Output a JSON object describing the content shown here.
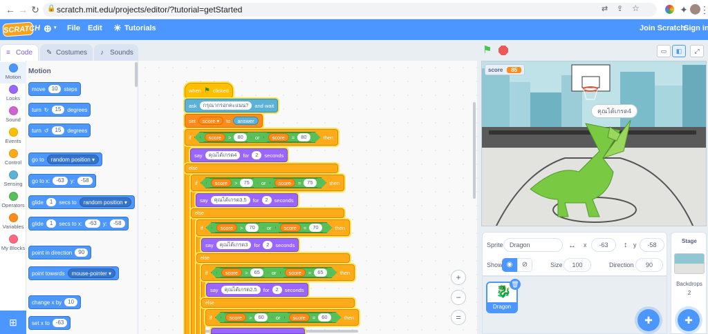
{
  "browser": {
    "url": "scratch.mit.edu/projects/editor/?tutorial=getStarted"
  },
  "menubar": {
    "logo": "SCRATCH",
    "file": "File",
    "edit": "Edit",
    "tutorials": "Tutorials",
    "join": "Join Scratch",
    "signin": "Sign in"
  },
  "tabs": {
    "code": "Code",
    "costumes": "Costumes",
    "sounds": "Sounds"
  },
  "categories": [
    {
      "label": "Motion",
      "color": "#4c97ff"
    },
    {
      "label": "Looks",
      "color": "#9966ff"
    },
    {
      "label": "Sound",
      "color": "#cf63cf"
    },
    {
      "label": "Events",
      "color": "#ffbf00"
    },
    {
      "label": "Control",
      "color": "#ffab19"
    },
    {
      "label": "Sensing",
      "color": "#5cb1d6"
    },
    {
      "label": "Operators",
      "color": "#59c059"
    },
    {
      "label": "Variables",
      "color": "#ff8c1a"
    },
    {
      "label": "My Blocks",
      "color": "#ff6680"
    }
  ],
  "palette": {
    "title": "Motion",
    "move": {
      "a": "move",
      "v": "10",
      "b": "steps"
    },
    "turn_right": {
      "a": "turn",
      "v": "15",
      "b": "degrees"
    },
    "turn_left": {
      "a": "turn",
      "v": "15",
      "b": "degrees"
    },
    "goto": {
      "a": "go to",
      "dd": "random position"
    },
    "gotoxy": {
      "a": "go to x:",
      "x": "-63",
      "b": "y:",
      "y": "-58"
    },
    "glide1": {
      "a": "glide",
      "v": "1",
      "b": "secs to",
      "dd": "random position"
    },
    "glide2": {
      "a": "glide",
      "v": "1",
      "b": "secs to x:",
      "x": "-63",
      "c": "y:",
      "y": "-58"
    },
    "point_dir": {
      "a": "point in direction",
      "v": "90"
    },
    "point_towards": {
      "a": "point towards",
      "dd": "mouse-pointer"
    },
    "change_x": {
      "a": "change x by",
      "v": "10"
    },
    "set_x": {
      "a": "set x to",
      "v": "-63"
    }
  },
  "script": {
    "when": {
      "a": "when",
      "b": "clicked"
    },
    "ask": {
      "a": "ask",
      "v": "กรุณากรอกคะแนน?",
      "b": "and wait"
    },
    "set": {
      "a": "set",
      "dd": "score",
      "b": "to",
      "v": "answer"
    },
    "if_label": "if",
    "then_label": "then",
    "else_label": "else",
    "or_label": "or",
    "say_label": "say",
    "for_label": "for",
    "seconds_label": "seconds",
    "var_name": "score",
    "gt": ">",
    "eq": "=",
    "conds": [
      {
        "gt_val": "80",
        "eq_val": "80",
        "msg": "คุณได้เกรด4",
        "secs": "2"
      },
      {
        "gt_val": "75",
        "eq_val": "75",
        "msg": "คุณได้เกรด3.5",
        "secs": "2"
      },
      {
        "gt_val": "70",
        "eq_val": "70",
        "msg": "คุณได้เกรด3",
        "secs": "2"
      },
      {
        "gt_val": "65",
        "eq_val": "65",
        "msg": "คุณได้เกรด2.5",
        "secs": "2"
      },
      {
        "gt_val": "60",
        "eq_val": "60"
      }
    ]
  },
  "zoom": {
    "in": "+",
    "out": "−",
    "reset": "="
  },
  "stage": {
    "score_label": "score",
    "score_value": "85",
    "speech": "คุณได้เกรด4"
  },
  "sprite_info": {
    "sprite_label": "Sprite",
    "sprite_name": "Dragon",
    "x_label": "x",
    "x_value": "-63",
    "y_label": "y",
    "y_value": "-58",
    "show_label": "Show",
    "size_label": "Size",
    "size_value": "100",
    "direction_label": "Direction",
    "direction_value": "90"
  },
  "sprite_tile": {
    "name": "Dragon"
  },
  "stage_panel": {
    "title": "Stage",
    "backdrops_label": "Backdrops",
    "backdrops_count": "2"
  }
}
